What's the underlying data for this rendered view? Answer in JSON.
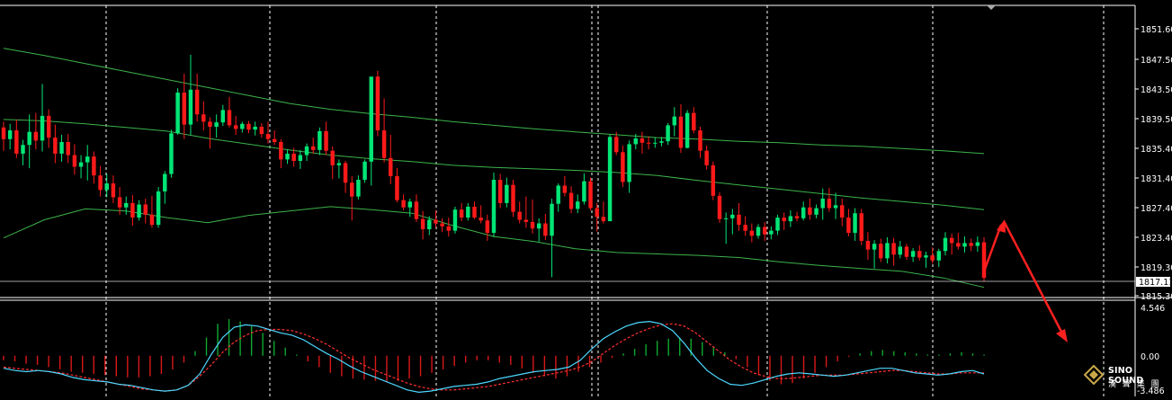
{
  "price_axis": {
    "labels": [
      "1851.60",
      "1847.50",
      "1843.50",
      "1839.50",
      "1835.40",
      "1831.40",
      "1827.40",
      "1823.40",
      "1819.30",
      "1815.30"
    ],
    "current_price": "1817.11"
  },
  "osc_axis": {
    "labels": [
      "4.546",
      "0.00",
      "-3.486"
    ]
  },
  "logo": {
    "brand": "SINO SOUND",
    "sub": "漢 聲 集 團"
  },
  "colors": {
    "background": "#000000",
    "bull_candle": "#00e676",
    "bear_candle": "#ff1a1a",
    "bands": "#3cb34a",
    "grid": "#ffffff",
    "macd_line": "#4dd8ff",
    "signal_line": "#ff3030",
    "arrow": "#ff2020"
  },
  "chart_data": {
    "type": "candlestick",
    "y_range": [
      1814.4,
      1854.6
    ],
    "osc_range": [
      -3.486,
      4.546
    ],
    "candles": [
      [
        1837.8,
        1838.6,
        1834.6,
        1836.2
      ],
      [
        1836.2,
        1838.3,
        1834.8,
        1837.4
      ],
      [
        1837.4,
        1838.9,
        1833.6,
        1834.2
      ],
      [
        1834.2,
        1836.1,
        1832.6,
        1835.4
      ],
      [
        1835.4,
        1839.6,
        1832.2,
        1837.2
      ],
      [
        1837.2,
        1839.8,
        1834.8,
        1836.0
      ],
      [
        1836.0,
        1843.8,
        1834.5,
        1839.4
      ],
      [
        1839.4,
        1840.3,
        1835.0,
        1836.4
      ],
      [
        1836.4,
        1838.2,
        1832.9,
        1834.2
      ],
      [
        1834.2,
        1836.8,
        1833.1,
        1835.8
      ],
      [
        1835.8,
        1836.9,
        1832.9,
        1834.0
      ],
      [
        1834.0,
        1835.5,
        1831.3,
        1832.4
      ],
      [
        1832.4,
        1834.0,
        1830.8,
        1833.0
      ],
      [
        1833.0,
        1835.4,
        1830.5,
        1833.8
      ],
      [
        1833.8,
        1834.5,
        1830.1,
        1831.2
      ],
      [
        1831.2,
        1832.5,
        1828.3,
        1829.2
      ],
      [
        1829.2,
        1831.4,
        1828.2,
        1830.1
      ],
      [
        1830.1,
        1831.2,
        1827.4,
        1828.2
      ],
      [
        1828.2,
        1829.6,
        1825.8,
        1826.8
      ],
      [
        1826.8,
        1828.3,
        1825.8,
        1827.4
      ],
      [
        1827.4,
        1828.5,
        1824.3,
        1825.4
      ],
      [
        1825.4,
        1827.8,
        1825.0,
        1827.2
      ],
      [
        1827.2,
        1828.0,
        1824.6,
        1825.8
      ],
      [
        1825.8,
        1828.4,
        1824.0,
        1824.4
      ],
      [
        1824.4,
        1829.6,
        1824.0,
        1829.0
      ],
      [
        1829.0,
        1831.8,
        1827.3,
        1831.4
      ],
      [
        1831.4,
        1837.5,
        1830.9,
        1837.0
      ],
      [
        1837.0,
        1843.2,
        1836.8,
        1842.6
      ],
      [
        1842.6,
        1845.2,
        1836.2,
        1838.2
      ],
      [
        1838.2,
        1847.8,
        1836.8,
        1843.0
      ],
      [
        1843.0,
        1845.2,
        1838.6,
        1839.6
      ],
      [
        1839.6,
        1841.4,
        1837.4,
        1838.6
      ],
      [
        1838.6,
        1839.2,
        1834.9,
        1837.9
      ],
      [
        1837.9,
        1839.6,
        1836.4,
        1838.5
      ],
      [
        1838.5,
        1840.9,
        1838.0,
        1840.2
      ],
      [
        1840.2,
        1842.0,
        1837.8,
        1838.1
      ],
      [
        1838.1,
        1839.4,
        1836.8,
        1837.6
      ],
      [
        1837.6,
        1838.6,
        1837.1,
        1838.3
      ],
      [
        1838.3,
        1838.7,
        1837.0,
        1837.5
      ],
      [
        1837.5,
        1838.6,
        1836.7,
        1837.9
      ],
      [
        1837.9,
        1838.4,
        1836.4,
        1836.9
      ],
      [
        1836.9,
        1838.6,
        1835.6,
        1836.2
      ],
      [
        1836.2,
        1837.4,
        1835.4,
        1835.8
      ],
      [
        1835.8,
        1836.2,
        1832.2,
        1833.4
      ],
      [
        1833.4,
        1834.8,
        1832.8,
        1834.2
      ],
      [
        1834.2,
        1835.0,
        1832.4,
        1833.2
      ],
      [
        1833.2,
        1834.7,
        1832.1,
        1834.0
      ],
      [
        1834.0,
        1835.6,
        1833.2,
        1835.2
      ],
      [
        1835.2,
        1836.4,
        1834.2,
        1834.7
      ],
      [
        1834.7,
        1837.8,
        1834.0,
        1837.3
      ],
      [
        1837.3,
        1838.6,
        1834.0,
        1834.6
      ],
      [
        1834.6,
        1835.2,
        1830.7,
        1832.6
      ],
      [
        1832.6,
        1833.4,
        1830.8,
        1832.9
      ],
      [
        1832.9,
        1833.2,
        1828.8,
        1830.2
      ],
      [
        1830.2,
        1831.1,
        1825.0,
        1828.3
      ],
      [
        1828.3,
        1831.2,
        1827.9,
        1830.6
      ],
      [
        1830.6,
        1833.4,
        1830.2,
        1833.1
      ],
      [
        1833.1,
        1838.5,
        1829.8,
        1844.8
      ],
      [
        1844.8,
        1845.6,
        1836.6,
        1837.4
      ],
      [
        1837.4,
        1841.8,
        1833.0,
        1833.6
      ],
      [
        1833.6,
        1836.8,
        1830.0,
        1831.1
      ],
      [
        1831.1,
        1832.2,
        1827.5,
        1827.8
      ],
      [
        1827.8,
        1828.6,
        1826.4,
        1826.8
      ],
      [
        1826.8,
        1828.0,
        1825.5,
        1827.6
      ],
      [
        1827.6,
        1828.6,
        1824.8,
        1825.2
      ],
      [
        1825.2,
        1826.3,
        1822.4,
        1823.8
      ],
      [
        1823.8,
        1825.6,
        1823.0,
        1825.1
      ],
      [
        1825.1,
        1826.4,
        1824.0,
        1824.6
      ],
      [
        1824.6,
        1825.3,
        1823.4,
        1824.2
      ],
      [
        1824.2,
        1825.4,
        1822.8,
        1823.6
      ],
      [
        1823.6,
        1826.9,
        1823.2,
        1826.5
      ],
      [
        1826.5,
        1827.4,
        1824.9,
        1825.4
      ],
      [
        1825.4,
        1827.4,
        1825.0,
        1826.9
      ],
      [
        1826.9,
        1827.6,
        1825.2,
        1825.4
      ],
      [
        1825.4,
        1827.1,
        1824.6,
        1825.0
      ],
      [
        1825.0,
        1825.8,
        1822.2,
        1823.3
      ],
      [
        1823.3,
        1831.6,
        1822.7,
        1830.6
      ],
      [
        1830.6,
        1831.4,
        1826.7,
        1827.4
      ],
      [
        1827.4,
        1830.9,
        1826.8,
        1829.9
      ],
      [
        1829.9,
        1830.6,
        1825.5,
        1826.2
      ],
      [
        1826.2,
        1827.6,
        1824.6,
        1825.1
      ],
      [
        1825.1,
        1828.3,
        1824.0,
        1824.8
      ],
      [
        1824.8,
        1827.9,
        1823.2,
        1823.9
      ],
      [
        1823.9,
        1825.3,
        1822.1,
        1824.6
      ],
      [
        1824.6,
        1825.9,
        1822.3,
        1822.9
      ],
      [
        1822.9,
        1828.0,
        1817.2,
        1827.3
      ],
      [
        1827.3,
        1830.1,
        1826.2,
        1829.8
      ],
      [
        1829.8,
        1831.1,
        1828.3,
        1828.8
      ],
      [
        1828.8,
        1829.7,
        1826.0,
        1826.6
      ],
      [
        1826.6,
        1828.6,
        1826.0,
        1827.6
      ],
      [
        1827.6,
        1831.5,
        1827.2,
        1830.4
      ],
      [
        1830.4,
        1830.9,
        1826.4,
        1826.7
      ],
      [
        1826.7,
        1827.4,
        1823.5,
        1825.5
      ],
      [
        1825.5,
        1827.6,
        1824.6,
        1824.9
      ],
      [
        1824.9,
        1836.8,
        1825.0,
        1836.5
      ],
      [
        1836.5,
        1837.2,
        1834.0,
        1834.4
      ],
      [
        1834.4,
        1835.3,
        1829.6,
        1830.3
      ],
      [
        1830.3,
        1836.0,
        1828.8,
        1835.5
      ],
      [
        1835.5,
        1836.9,
        1834.8,
        1836.3
      ],
      [
        1836.3,
        1837.2,
        1834.2,
        1835.7
      ],
      [
        1835.7,
        1836.6,
        1834.8,
        1835.6
      ],
      [
        1835.6,
        1836.4,
        1835.0,
        1835.7
      ],
      [
        1835.7,
        1836.5,
        1835.2,
        1835.9
      ],
      [
        1835.9,
        1838.4,
        1835.4,
        1838.1
      ],
      [
        1838.1,
        1840.6,
        1836.6,
        1839.3
      ],
      [
        1839.3,
        1841.0,
        1834.3,
        1835.0
      ],
      [
        1835.0,
        1840.2,
        1834.9,
        1839.8
      ],
      [
        1839.8,
        1840.6,
        1837.0,
        1837.4
      ],
      [
        1837.4,
        1837.9,
        1833.6,
        1834.6
      ],
      [
        1834.6,
        1835.3,
        1832.0,
        1832.6
      ],
      [
        1832.6,
        1833.1,
        1827.8,
        1828.4
      ],
      [
        1828.4,
        1828.9,
        1824.7,
        1825.2
      ],
      [
        1825.2,
        1826.1,
        1821.8,
        1825.3
      ],
      [
        1825.3,
        1826.6,
        1823.1,
        1825.8
      ],
      [
        1825.8,
        1827.4,
        1823.6,
        1824.4
      ],
      [
        1824.4,
        1825.6,
        1822.9,
        1823.6
      ],
      [
        1823.6,
        1824.6,
        1822.0,
        1822.9
      ],
      [
        1822.9,
        1824.5,
        1822.5,
        1824.1
      ],
      [
        1824.1,
        1824.8,
        1822.2,
        1823.1
      ],
      [
        1823.1,
        1824.2,
        1822.4,
        1823.6
      ],
      [
        1823.6,
        1825.8,
        1823.0,
        1825.4
      ],
      [
        1825.4,
        1826.1,
        1823.7,
        1824.9
      ],
      [
        1824.9,
        1826.4,
        1824.1,
        1825.6
      ],
      [
        1825.6,
        1826.2,
        1824.9,
        1825.3
      ],
      [
        1825.3,
        1827.6,
        1825.0,
        1826.8
      ],
      [
        1826.8,
        1828.0,
        1825.1,
        1825.8
      ],
      [
        1825.8,
        1827.2,
        1825.3,
        1826.7
      ],
      [
        1826.7,
        1829.4,
        1825.1,
        1828.0
      ],
      [
        1828.0,
        1829.5,
        1826.2,
        1826.7
      ],
      [
        1826.7,
        1828.8,
        1825.2,
        1827.1
      ],
      [
        1827.1,
        1828.0,
        1824.2,
        1825.4
      ],
      [
        1825.4,
        1826.6,
        1822.8,
        1823.3
      ],
      [
        1823.3,
        1826.7,
        1822.2,
        1826.0
      ],
      [
        1826.0,
        1826.6,
        1821.6,
        1822.2
      ],
      [
        1822.2,
        1823.4,
        1819.6,
        1821.0
      ],
      [
        1821.0,
        1822.3,
        1818.4,
        1821.8
      ],
      [
        1821.8,
        1822.5,
        1819.3,
        1819.8
      ],
      [
        1819.8,
        1822.7,
        1819.1,
        1821.9
      ],
      [
        1821.9,
        1822.6,
        1818.8,
        1820.3
      ],
      [
        1820.3,
        1822.2,
        1819.8,
        1821.4
      ],
      [
        1821.4,
        1821.8,
        1819.6,
        1820.0
      ],
      [
        1820.0,
        1821.2,
        1819.3,
        1820.8
      ],
      [
        1820.8,
        1821.6,
        1819.5,
        1819.9
      ],
      [
        1819.9,
        1820.7,
        1818.5,
        1820.2
      ],
      [
        1820.2,
        1821.3,
        1819.1,
        1819.5
      ],
      [
        1819.5,
        1821.1,
        1818.6,
        1820.8
      ],
      [
        1820.8,
        1823.4,
        1820.2,
        1822.6
      ],
      [
        1822.6,
        1823.2,
        1820.3,
        1821.9
      ],
      [
        1821.9,
        1823.3,
        1821.0,
        1821.4
      ],
      [
        1821.4,
        1822.8,
        1820.6,
        1821.9
      ],
      [
        1821.9,
        1822.5,
        1820.8,
        1821.5
      ],
      [
        1821.5,
        1822.8,
        1820.7,
        1822.0
      ],
      [
        1822.0,
        1822.7,
        1816.6,
        1817.1
      ]
    ],
    "upper_band": [
      1848.7,
      1847.7,
      1846.6,
      1845.5,
      1844.4,
      1843.3,
      1842.2,
      1841.1,
      1840.3,
      1839.7,
      1839.2,
      1838.6,
      1838.1,
      1837.6,
      1837.2,
      1836.8,
      1836.4,
      1836.2,
      1835.9,
      1835.7,
      1835.4,
      1835.2,
      1834.9,
      1834.6,
      1834.2
    ],
    "middle_band": [
      1838.9,
      1838.7,
      1838.3,
      1837.8,
      1837.3,
      1836.3,
      1835.5,
      1834.7,
      1834.0,
      1833.5,
      1833.1,
      1832.6,
      1832.3,
      1832.1,
      1831.9,
      1831.6,
      1831.2,
      1830.5,
      1829.9,
      1829.3,
      1828.7,
      1828.1,
      1827.6,
      1827.1,
      1826.5
    ],
    "lower_band": [
      1822.6,
      1825.1,
      1826.6,
      1826.3,
      1825.4,
      1824.7,
      1825.7,
      1826.3,
      1826.9,
      1826.5,
      1826.0,
      1824.3,
      1822.8,
      1822.1,
      1821.1,
      1820.6,
      1820.4,
      1820.2,
      1819.9,
      1819.3,
      1818.8,
      1818.4,
      1818.0,
      1817.1,
      1815.8
    ],
    "macd_hist": [
      -0.4,
      -0.5,
      -0.7,
      -0.8,
      -1.0,
      -1.2,
      -1.4,
      -1.5,
      -1.6,
      -1.7,
      -1.8,
      -1.9,
      -1.9,
      -1.8,
      -1.6,
      -1.2,
      -0.6,
      0.4,
      1.6,
      2.8,
      3.2,
      3.0,
      2.6,
      2.0,
      1.3,
      0.7,
      0.1,
      -0.5,
      -1.0,
      -1.5,
      -1.8,
      -2.0,
      -2.1,
      -2.2,
      -2.3,
      -2.2,
      -2.0,
      -1.8,
      -1.5,
      -1.2,
      -0.9,
      -0.6,
      -0.4,
      -0.4,
      -0.6,
      -0.8,
      -1.1,
      -1.5,
      -1.8,
      -2.0,
      -1.8,
      -1.4,
      -1.0,
      -0.6,
      -0.2,
      0.2,
      0.6,
      1.0,
      1.3,
      1.5,
      1.6,
      1.5,
      1.2,
      0.8,
      0.3,
      -0.3,
      -1.0,
      -1.7,
      -2.2,
      -2.5,
      -2.4,
      -2.0,
      -1.5,
      -1.0,
      -0.5,
      -0.1,
      0.2,
      0.4,
      0.5,
      0.4,
      0.3,
      0.2,
      0.1,
      0.1,
      0.2,
      0.3,
      0.2,
      0.1
    ],
    "macd_line": [
      -1.1,
      -1.3,
      -1.4,
      -1.3,
      -1.4,
      -1.6,
      -1.9,
      -2.1,
      -2.2,
      -2.3,
      -2.5,
      -2.6,
      -2.8,
      -3.0,
      -3.1,
      -3.0,
      -2.6,
      -1.6,
      0.1,
      1.6,
      2.5,
      2.7,
      2.6,
      2.3,
      2.0,
      1.8,
      1.4,
      0.8,
      0.2,
      -0.3,
      -0.9,
      -1.4,
      -1.8,
      -2.2,
      -2.6,
      -3.0,
      -3.2,
      -3.1,
      -2.9,
      -2.7,
      -2.6,
      -2.5,
      -2.3,
      -2.0,
      -1.8,
      -1.6,
      -1.4,
      -1.3,
      -1.2,
      -1.0,
      -0.4,
      0.6,
      1.5,
      2.1,
      2.6,
      2.9,
      3.0,
      2.8,
      2.2,
      1.1,
      -0.2,
      -1.3,
      -2.0,
      -2.5,
      -2.6,
      -2.4,
      -2.1,
      -1.8,
      -1.6,
      -1.5,
      -1.6,
      -1.7,
      -1.8,
      -1.7,
      -1.5,
      -1.3,
      -1.1,
      -1.1,
      -1.3,
      -1.5,
      -1.6,
      -1.7,
      -1.6,
      -1.4,
      -1.3,
      -1.6
    ],
    "signal_line": [
      -1.0,
      -1.1,
      -1.2,
      -1.3,
      -1.4,
      -1.5,
      -1.7,
      -1.9,
      -2.1,
      -2.3,
      -2.5,
      -2.7,
      -2.9,
      -3.0,
      -3.1,
      -3.0,
      -2.6,
      -1.8,
      -0.8,
      0.3,
      1.2,
      1.8,
      2.2,
      2.3,
      2.3,
      2.2,
      1.9,
      1.5,
      1.0,
      0.4,
      -0.2,
      -0.7,
      -1.2,
      -1.6,
      -2.0,
      -2.4,
      -2.7,
      -2.9,
      -3.0,
      -3.0,
      -2.9,
      -2.8,
      -2.7,
      -2.5,
      -2.3,
      -2.1,
      -1.9,
      -1.7,
      -1.5,
      -1.3,
      -1.0,
      -0.5,
      0.2,
      0.9,
      1.5,
      2.0,
      2.4,
      2.7,
      2.8,
      2.6,
      2.0,
      1.2,
      0.4,
      -0.4,
      -1.0,
      -1.5,
      -1.8,
      -2.0,
      -2.0,
      -1.9,
      -1.8,
      -1.7,
      -1.7,
      -1.7,
      -1.6,
      -1.5,
      -1.4,
      -1.3,
      -1.3,
      -1.4,
      -1.5,
      -1.6,
      -1.6,
      -1.5,
      -1.5,
      -1.5
    ]
  }
}
